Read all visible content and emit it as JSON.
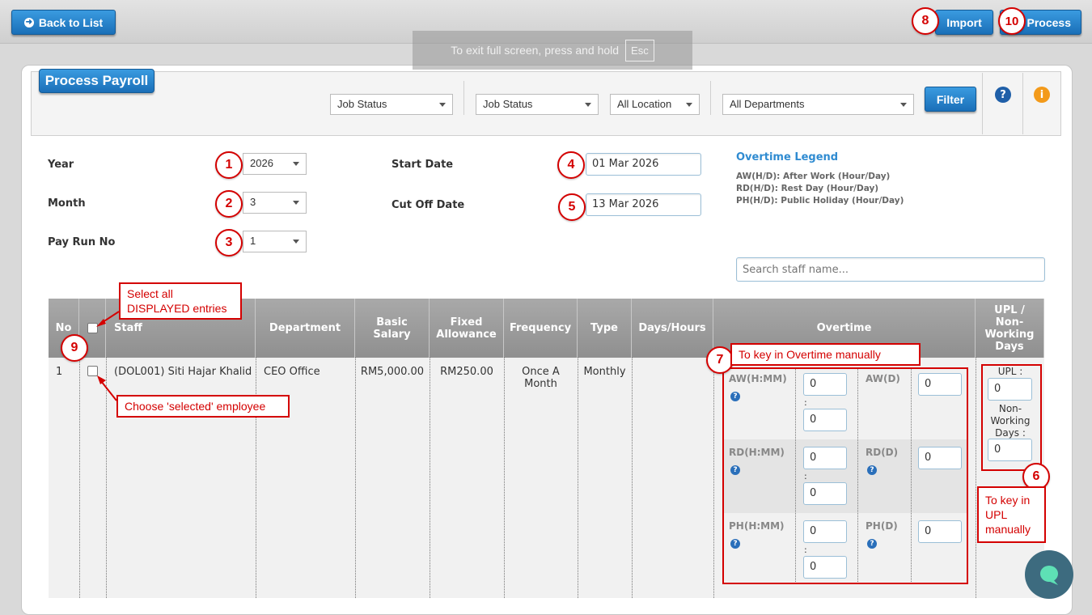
{
  "topbar": {
    "back_label": "Back to List",
    "import_label": "Import",
    "process_label": "Process"
  },
  "overlay": {
    "text": "To exit full screen, press and hold",
    "key": "Esc"
  },
  "panel": {
    "title": "Process Payroll"
  },
  "filters": {
    "job_status_1": "Job Status",
    "job_status_2": "Job Status",
    "location": "All Location",
    "departments": "All Departments",
    "filter_label": "Filter"
  },
  "icons": {
    "help": "?",
    "info": "i"
  },
  "form": {
    "year_label": "Year",
    "year_value": "2026",
    "month_label": "Month",
    "month_value": "3",
    "payrun_label": "Pay Run No",
    "payrun_value": "1",
    "start_label": "Start Date",
    "start_value": "01 Mar 2026",
    "cutoff_label": "Cut Off Date",
    "cutoff_value": "13 Mar 2026"
  },
  "legend": {
    "title": "Overtime Legend",
    "aw": "AW(H/D): After Work (Hour/Day)",
    "rd": "RD(H/D): Rest Day (Hour/Day)",
    "ph": "PH(H/D): Public Holiday (Hour/Day)"
  },
  "search": {
    "placeholder": "Search staff name..."
  },
  "table": {
    "headers": {
      "no": "No",
      "staff": "Staff",
      "department": "Department",
      "basic_salary": "Basic Salary",
      "fixed_allowance": "Fixed Allowance",
      "frequency": "Frequency",
      "type": "Type",
      "days_hours": "Days/Hours",
      "overtime": "Overtime",
      "upl": "UPL / Non-Working Days"
    },
    "row": {
      "no": "1",
      "staff": "(DOL001) Siti Hajar Khalid",
      "department": "CEO Office",
      "basic_salary": "RM5,000.00",
      "fixed_allowance": "RM250.00",
      "frequency": "Once A Month",
      "type": "Monthly"
    },
    "overtime": {
      "aw_hm": "AW(H:MM)",
      "aw_d": "AW(D)",
      "rd_hm": "RD(H:MM)",
      "rd_d": "RD(D)",
      "ph_hm": "PH(H:MM)",
      "ph_d": "PH(D)",
      "aw_h": "0",
      "aw_m": "0",
      "aw_day": "0",
      "rd_h": "0",
      "rd_m": "0",
      "rd_day": "0",
      "ph_h": "0",
      "ph_m": "0",
      "ph_day": "0",
      "sep": ":"
    },
    "upl": {
      "upl_label": "UPL :",
      "upl_value": "0",
      "nwd_label": "Non-Working Days :",
      "nwd_value": "0"
    }
  },
  "annotations": {
    "b1": "1",
    "b2": "2",
    "b3": "3",
    "b4": "4",
    "b5": "5",
    "b6": "6",
    "b7": "7",
    "b8": "8",
    "b9": "9",
    "b10": "10",
    "select_all": "Select all DISPLAYED entries",
    "choose": "Choose 'selected' employee",
    "overtime_note": "To key in Overtime manually",
    "upl_note": "To key in UPL manually"
  },
  "colors": {
    "accent": "#1a6fb8",
    "annotation": "#d40000",
    "header_gray": "#9a9a9a"
  }
}
